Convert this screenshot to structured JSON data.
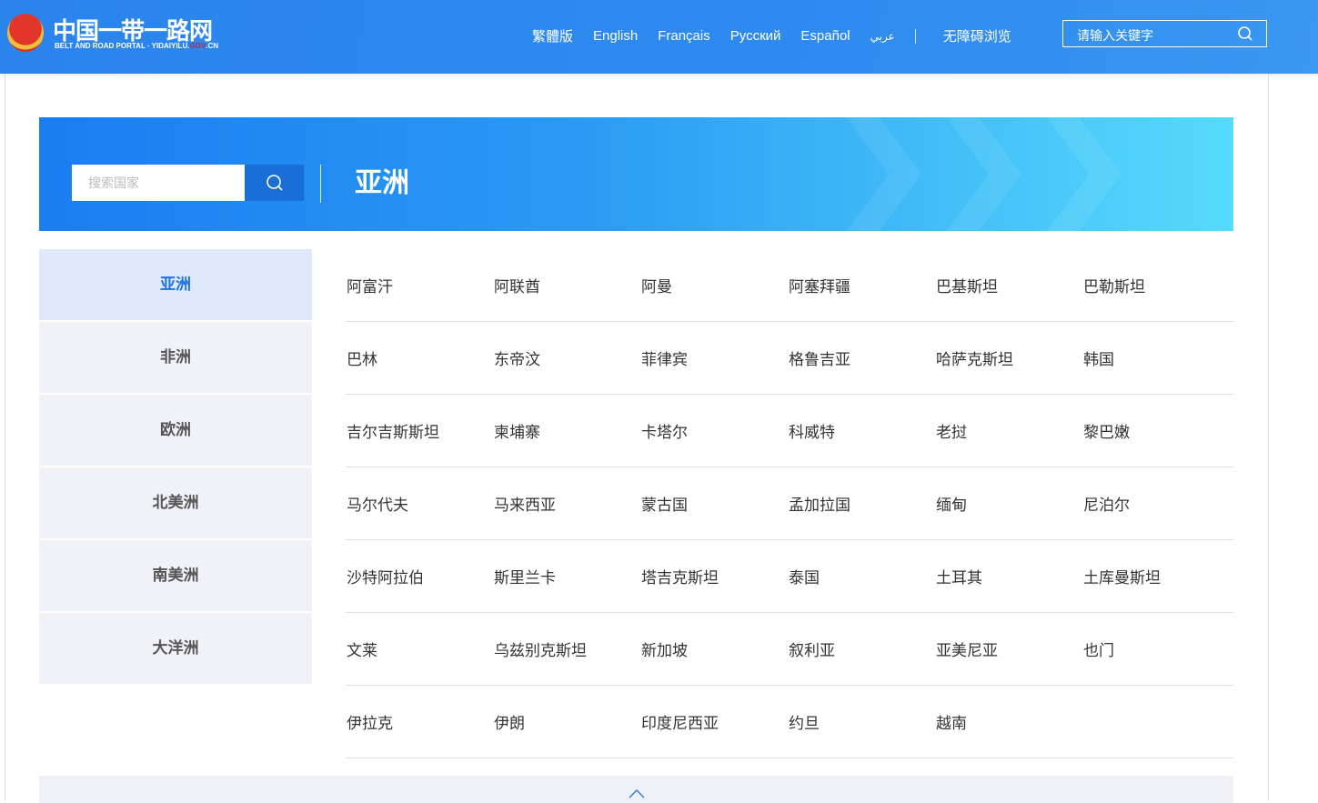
{
  "header": {
    "logo_cn": "中国一带一路网",
    "logo_en_prefix": "BELT AND ROAD PORTAL · YIDAIYILU.",
    "logo_en_gov": "GOV",
    "logo_en_suffix": ".CN",
    "languages": [
      "繁體版",
      "English",
      "Français",
      "Русский",
      "Español",
      "عربي"
    ],
    "accessibility": "无障碍浏览",
    "search_placeholder": "请输入关键字"
  },
  "banner": {
    "search_placeholder": "搜索国家",
    "title": "亚洲"
  },
  "sidebar": [
    {
      "label": "亚洲",
      "active": true
    },
    {
      "label": "非洲"
    },
    {
      "label": "欧洲"
    },
    {
      "label": "北美洲"
    },
    {
      "label": "南美洲"
    },
    {
      "label": "大洋洲"
    }
  ],
  "countries": [
    [
      "阿富汗",
      "阿联酋",
      "阿曼",
      "阿塞拜疆",
      "巴基斯坦",
      "巴勒斯坦"
    ],
    [
      "巴林",
      "东帝汶",
      "菲律宾",
      "格鲁吉亚",
      "哈萨克斯坦",
      "韩国"
    ],
    [
      "吉尔吉斯斯坦",
      "柬埔寨",
      "卡塔尔",
      "科威特",
      "老挝",
      "黎巴嫩"
    ],
    [
      "马尔代夫",
      "马来西亚",
      "蒙古国",
      "孟加拉国",
      "缅甸",
      "尼泊尔"
    ],
    [
      "沙特阿拉伯",
      "斯里兰卡",
      "塔吉克斯坦",
      "泰国",
      "土耳其",
      "土库曼斯坦"
    ],
    [
      "文莱",
      "乌兹别克斯坦",
      "新加坡",
      "叙利亚",
      "亚美尼亚",
      "也门"
    ],
    [
      "伊拉克",
      "伊朗",
      "印度尼西亚",
      "约旦",
      "越南"
    ]
  ],
  "colors": {
    "header": "#2a84ec",
    "active": "#1a73e8",
    "button": "#1a6fd6"
  }
}
